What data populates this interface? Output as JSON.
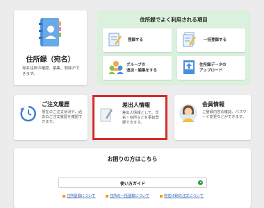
{
  "address_book": {
    "title": "住所録（宛名）",
    "description": "宛名住所の確認、編集、削除ができます。"
  },
  "frequent": {
    "title": "住所録でよく利用される項目",
    "items": [
      {
        "label": "登録する",
        "icon": "pencil-document-icon"
      },
      {
        "label": "一括登録する",
        "icon": "bulk-pencil-icon"
      },
      {
        "label": "グループの\n追加・編集をする",
        "icon": "group-people-icon"
      },
      {
        "label": "住所録データの\nアップロード",
        "icon": "upload-document-icon"
      }
    ]
  },
  "cards": {
    "history": {
      "title": "ご注文履歴",
      "description": "現在のご注文状況や、過去のご注文履歴を確認できます。",
      "icon": "clock-icon"
    },
    "sender": {
      "title": "差出人情報",
      "description": "差出人情報として、氏名・住所などを事前登録できます。",
      "icon": "pen-card-icon"
    },
    "account": {
      "title": "会員情報",
      "description": "ご登録内容の確認、パスワード変更などができます。",
      "icon": "person-avatar-icon"
    }
  },
  "help": {
    "title": "お困りの方はこちら",
    "guide_label": "使い方ガイド",
    "links": [
      "住所登録について",
      "住所の一括登録について",
      "宛名印刷の注文について"
    ]
  },
  "colors": {
    "accent_green": "#2e9a3a",
    "highlight_red": "#d62b2b",
    "link_blue": "#2f5fb3",
    "panel_green": "#dbf0dd"
  }
}
